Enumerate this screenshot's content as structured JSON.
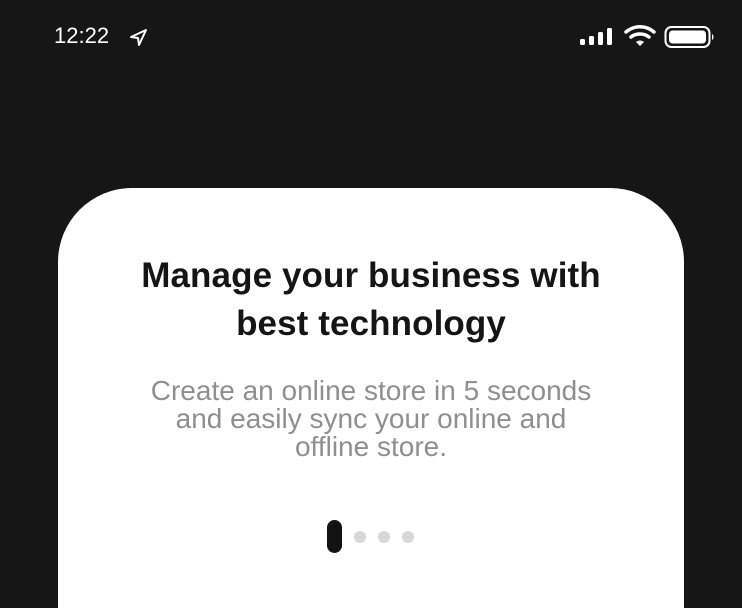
{
  "status_bar": {
    "time": "12:22",
    "icons": [
      "location-arrow-icon",
      "cellular-signal-icon",
      "wifi-icon",
      "battery-icon"
    ]
  },
  "onboarding": {
    "title_line_1": "Manage your business with",
    "title_line_2": "best technology",
    "subtitle_line_1": "Create an online store in 5 seconds",
    "subtitle_line_2": "and easily sync your online and",
    "subtitle_line_3": "offline store.",
    "current_page": 1,
    "page_count": 4
  },
  "colors": {
    "background": "#161616",
    "card": "#ffffff",
    "title": "#151515",
    "subtitle": "#8f8f8f",
    "active_indicator": "#121212",
    "inactive_indicator": "#d7d7d7"
  }
}
